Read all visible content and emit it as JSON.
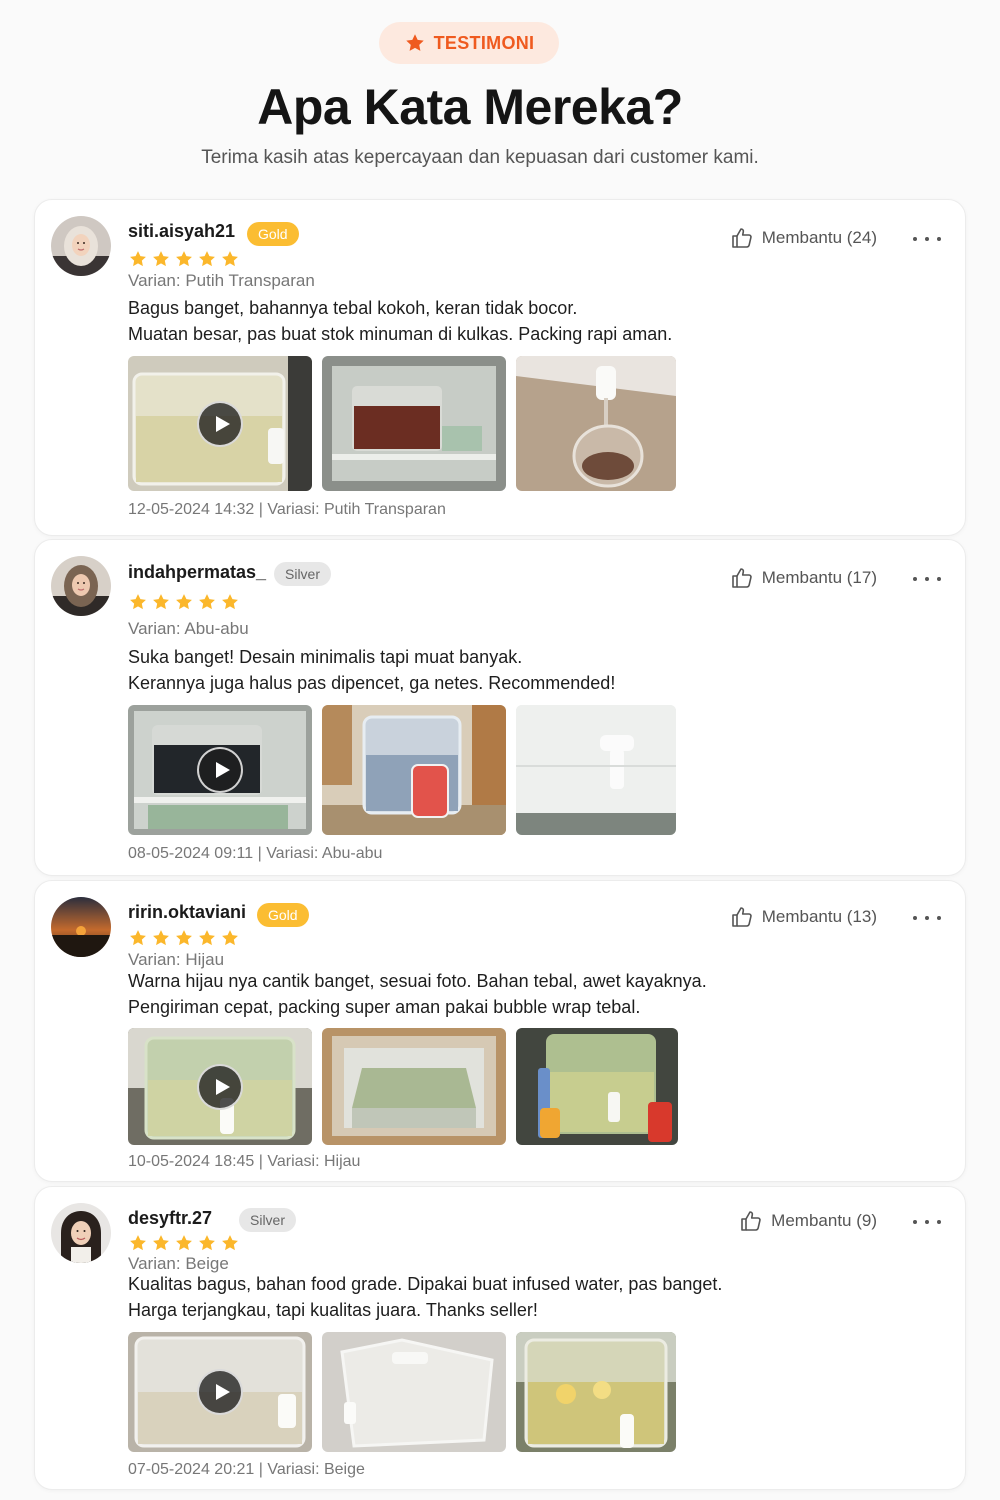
{
  "header": {
    "pill_icon": "star-icon",
    "pill_label": "TESTIMONI",
    "title": "Apa Kata Mereka?",
    "subtitle": "Terima kasih atas kepercayaan dan kepuasan dari customer kami.",
    "accent_color": "#ef5a1f"
  },
  "reviews": [
    {
      "username": "siti.aisyah21",
      "badge": "Gold",
      "rating": 5,
      "variant": "Varian: Putih Transparan",
      "text_line1": "Bagus banget, bahannya tebal kokoh, keran tidak bocor.",
      "text_line2": "Muatan besar, pas buat stok minuman di kulkas. Packing rapi aman.",
      "helpful": "Membantu (24)",
      "meta": "12-05-2024 14:32 | Variasi: Putih Transparan"
    },
    {
      "username": "indahpermatas_",
      "badge": "Silver",
      "rating": 5,
      "variant": "Varian: Abu-abu",
      "text_line1": "Suka banget! Desain minimalis tapi muat banyak.",
      "text_line2": "Kerannya juga halus pas dipencet, ga netes. Recommended!",
      "helpful": "Membantu (17)",
      "meta": "08-05-2024 09:11 | Variasi: Abu-abu"
    },
    {
      "username": "ririn.oktaviani",
      "badge": "Gold",
      "rating": 5,
      "variant": "Varian: Hijau",
      "text_line1": "Warna hijau nya cantik banget, sesuai foto. Bahan tebal, awet kayaknya.",
      "text_line2": "Pengiriman cepat, packing super aman pakai bubble wrap tebal.",
      "helpful": "Membantu (13)",
      "meta": "10-05-2024 18:45 | Variasi: Hijau"
    },
    {
      "username": "desyftr.27",
      "badge": "Silver",
      "rating": 5,
      "variant": "Varian: Beige",
      "text_line1": "Kualitas bagus, bahan food grade. Dipakai buat infused water, pas banget.",
      "text_line2": "Harga terjangkau, tapi kualitas juara. Thanks seller!",
      "helpful": "Membantu (9)",
      "meta": "07-05-2024 20:21 | Variasi: Beige"
    }
  ],
  "colors": {
    "gold_badge": "#fbbd32",
    "silver_badge": "#e7e7e7",
    "star": "#fbb72b"
  }
}
